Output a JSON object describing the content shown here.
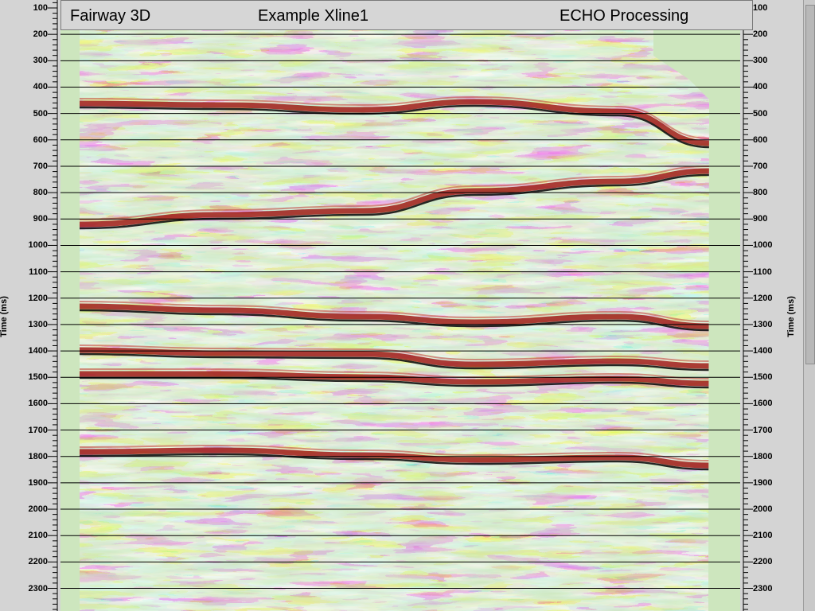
{
  "header": {
    "survey_name": "Fairway 3D",
    "line_name": "Example Xline1",
    "processor": "ECHO Processing"
  },
  "axis": {
    "left_title": "Time (ms)",
    "right_title": "Time (ms)",
    "ticks": [
      "100",
      "200",
      "300",
      "400",
      "500",
      "600",
      "700",
      "800",
      "900",
      "1000",
      "1100",
      "1200",
      "1300",
      "1400",
      "1500",
      "1600",
      "1700",
      "1800",
      "1900",
      "2000",
      "2100",
      "2200",
      "2300"
    ],
    "tick_values_ms": [
      100,
      200,
      300,
      400,
      500,
      600,
      700,
      800,
      900,
      1000,
      1100,
      1200,
      1300,
      1400,
      1500,
      1600,
      1700,
      1800,
      1900,
      2000,
      2100,
      2200,
      2300
    ],
    "unit": "ms"
  },
  "section": {
    "background_color": "#cde6be",
    "colormap": [
      "#1a1a1a",
      "#ffffff",
      "#b5201c"
    ],
    "timing_lines": true
  },
  "icons": {
    "scrollbar": "vertical-scrollbar"
  }
}
